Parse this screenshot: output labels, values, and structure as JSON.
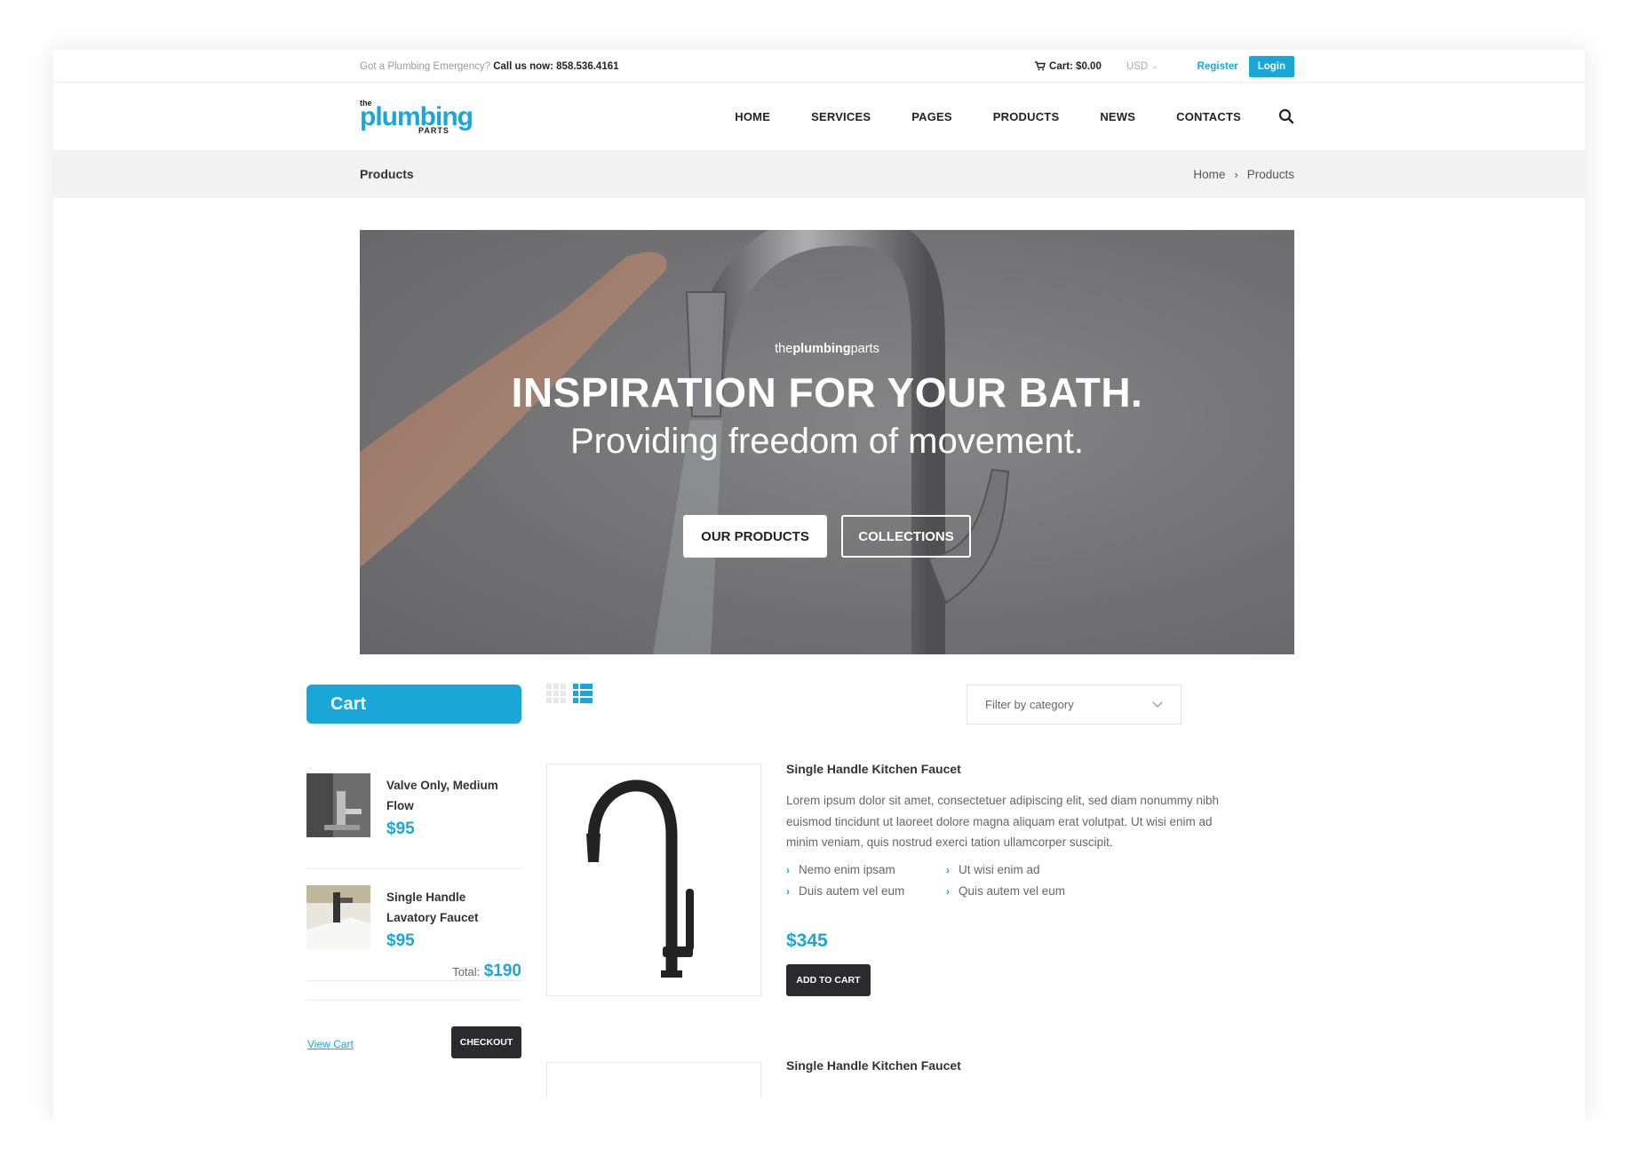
{
  "topbar": {
    "emergency_text": "Got a Plumbing Emergency?",
    "call_text": "Call us now: 858.536.4161",
    "cart_label": "Cart: $0.00",
    "currency": "USD",
    "register": "Register",
    "login": "Login"
  },
  "logo": {
    "the": "the",
    "plumbing": "plumbing",
    "parts": "PARTS"
  },
  "nav": {
    "items": [
      "HOME",
      "SERVICES",
      "PAGES",
      "PRODUCTS",
      "NEWS",
      "CONTACTS"
    ]
  },
  "breadcrumb": {
    "title": "Products",
    "home": "Home",
    "current": "Products"
  },
  "hero": {
    "brand_prefix": "the",
    "brand_bold": "plumbing",
    "brand_suffix": "parts",
    "headline": "INSPIRATION FOR YOUR BATH.",
    "subheadline": "Providing freedom of movement.",
    "btn_primary": "OUR PRODUCTS",
    "btn_secondary": "COLLECTIONS"
  },
  "cart": {
    "title": "Cart",
    "items": [
      {
        "name": "Valve Only, Medium Flow",
        "price": "$95"
      },
      {
        "name": "Single Handle Lavatory Faucet",
        "price": "$95"
      }
    ],
    "total_label": "Total:",
    "total_value": "$190",
    "view_cart": "View Cart",
    "checkout": "CHECKOUT"
  },
  "filter": {
    "placeholder": "Filter by category"
  },
  "products": [
    {
      "title": "Single Handle Kitchen Faucet",
      "description": "Lorem ipsum dolor sit amet, consectetuer adipiscing elit, sed diam nonummy nibh euismod tincidunt ut laoreet dolore magna aliquam erat volutpat. Ut wisi enim ad minim veniam, quis nostrud exerci tation ullamcorper suscipit.",
      "features": [
        "Nemo enim ipsam",
        "Ut wisi enim ad",
        "Duis autem vel eum",
        "Quis autem vel eum"
      ],
      "price": "$345",
      "add_to_cart": "ADD TO CART"
    },
    {
      "title": "Single Handle Kitchen Faucet"
    }
  ],
  "colors": {
    "accent": "#1aa7d8",
    "dark_button": "#2b2b2f",
    "band": "#f2f2f2"
  },
  "icons": {
    "cart": "cart-icon",
    "search": "search-icon",
    "grid_view": "grid-view-icon",
    "list_view": "list-view-icon",
    "dropdown": "chevron-down-icon"
  }
}
